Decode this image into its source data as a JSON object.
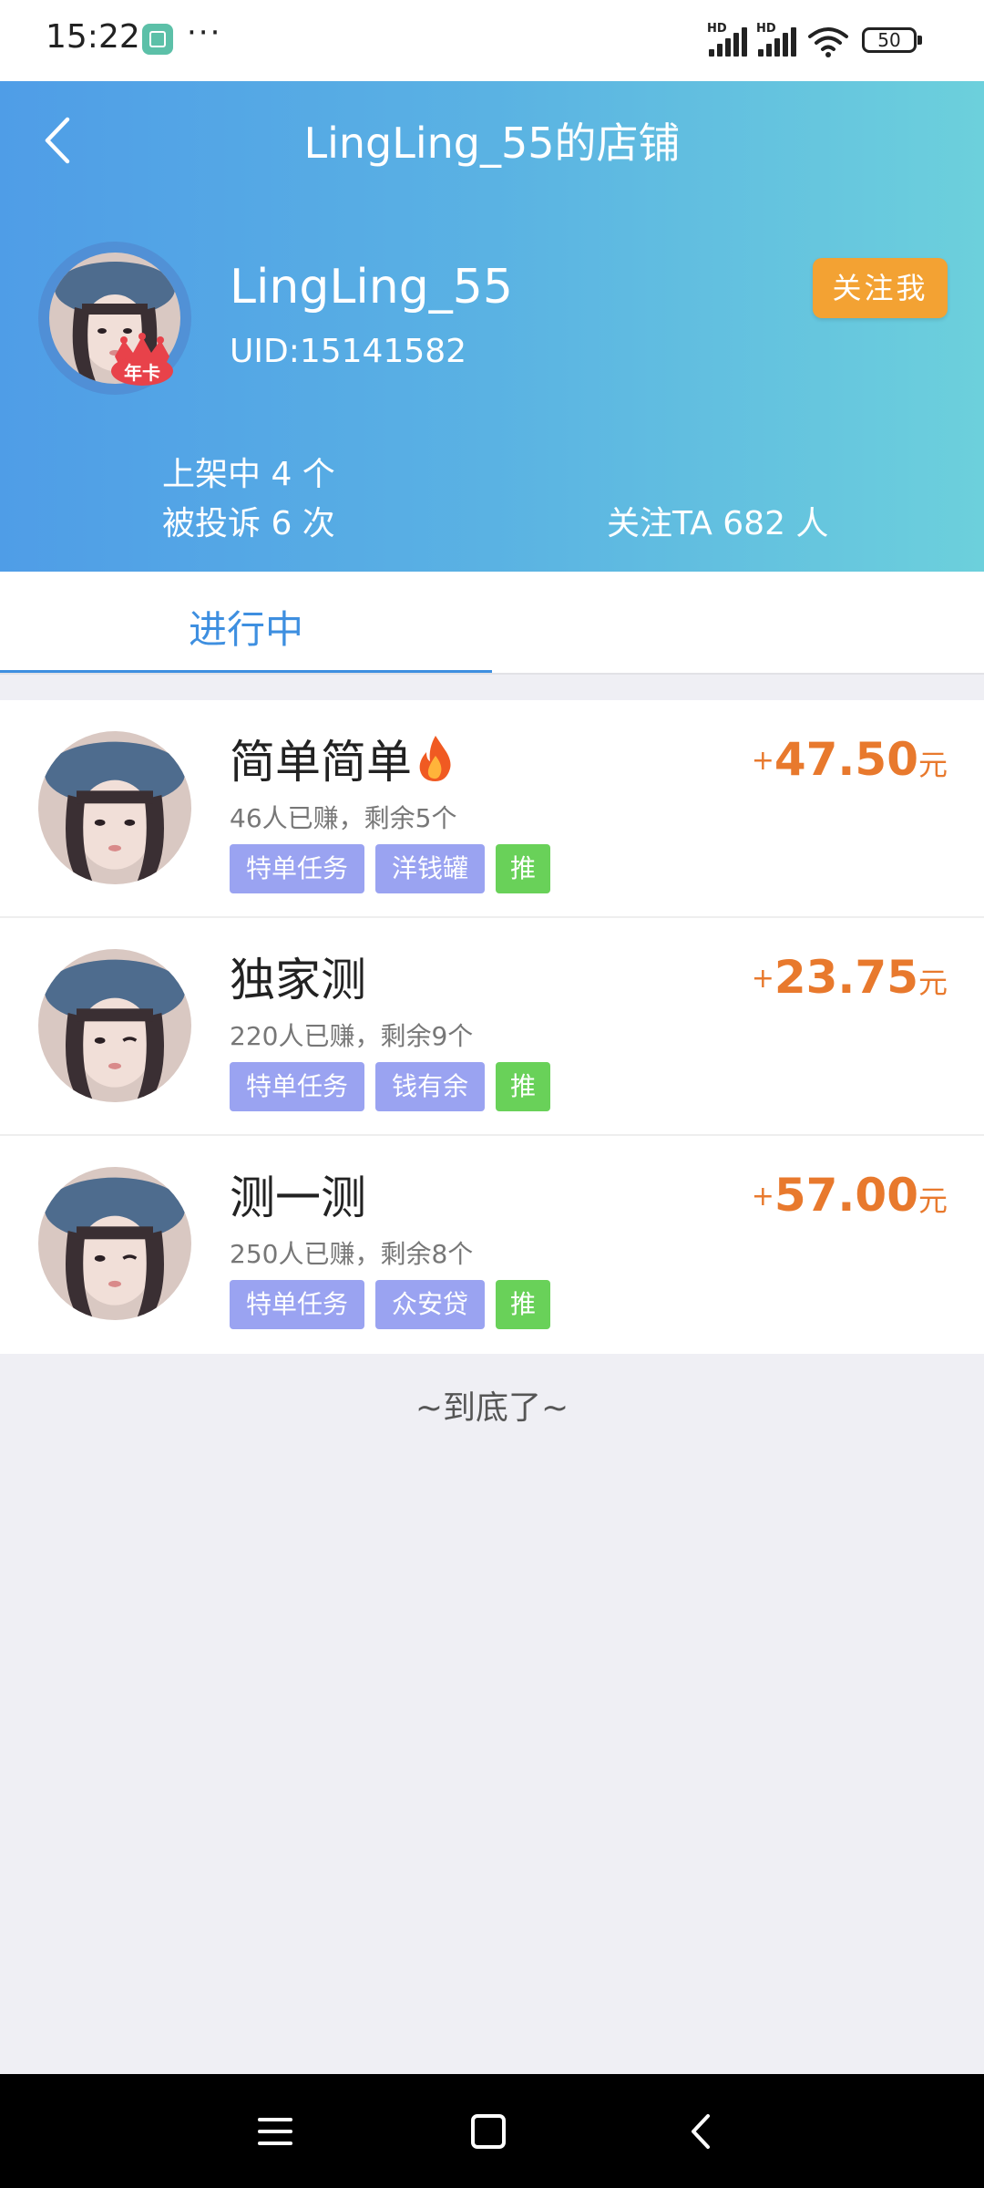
{
  "status_bar": {
    "time": "15:22",
    "app_icon": "app-notification-icon",
    "more_dots": "···",
    "signal1_label": "HD",
    "signal2_label": "HD",
    "battery": "50"
  },
  "header": {
    "title": "LingLing_55的店铺",
    "user_name": "LingLing_55",
    "uid": "UID:15141582",
    "badge_text": "年卡",
    "follow_label": "关注我",
    "stats": {
      "listed": "上架中 4 个",
      "complaints": "被投诉 6 次",
      "followers": "关注TA 682 人"
    }
  },
  "tabs": [
    {
      "label": "进行中",
      "active": true
    }
  ],
  "tasks": [
    {
      "title": "简单简单",
      "hot": true,
      "subtitle": "46人已赚，剩余5个",
      "tags": [
        "特单任务",
        "洋钱罐",
        "推"
      ],
      "reward_plus": "+",
      "reward_value": "47.50",
      "reward_unit": "元"
    },
    {
      "title": "独家测",
      "hot": false,
      "subtitle": "220人已赚，剩余9个",
      "tags": [
        "特单任务",
        "钱有余",
        "推"
      ],
      "reward_plus": "+",
      "reward_value": "23.75",
      "reward_unit": "元"
    },
    {
      "title": "测一测",
      "hot": false,
      "subtitle": "250人已赚，剩余8个",
      "tags": [
        "特单任务",
        "众安贷",
        "推"
      ],
      "reward_plus": "+",
      "reward_value": "57.00",
      "reward_unit": "元"
    }
  ],
  "end_text": "~到底了~",
  "colors": {
    "header_gradient_start": "#4f9de7",
    "header_gradient_end": "#6cd0dc",
    "follow_button": "#f3a233",
    "tab_active": "#3e8fe0",
    "tag_blue": "#9aa3f1",
    "tag_green": "#69d159",
    "reward": "#e8792d"
  },
  "nav_bar": {
    "icons": [
      "menu-icon",
      "home-icon",
      "back-icon"
    ]
  }
}
